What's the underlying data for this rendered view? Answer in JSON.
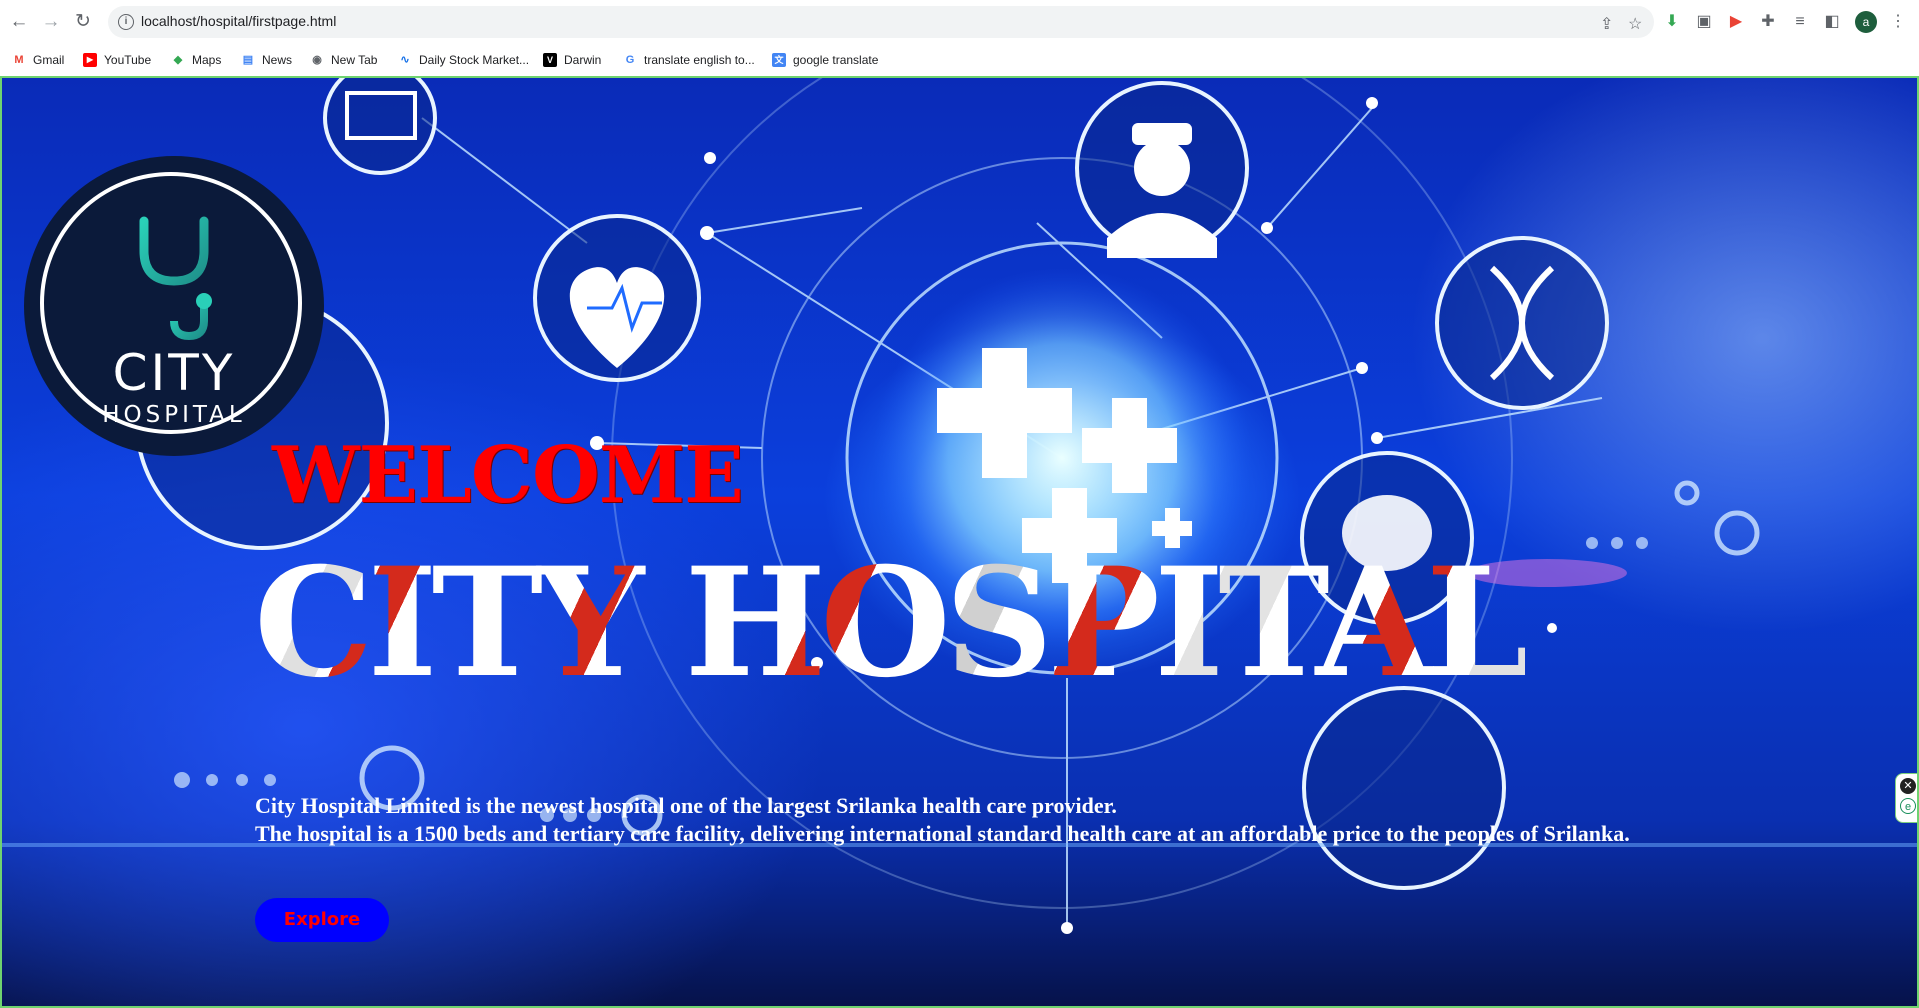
{
  "browser": {
    "url": "localhost/hospital/firstpage.html",
    "profile_initial": "a",
    "nav": {
      "back_icon": "←",
      "forward_icon": "→",
      "reload_icon": "↻"
    },
    "bookmarks": [
      {
        "label": "Gmail",
        "icon": "M",
        "color": "#ea4335"
      },
      {
        "label": "YouTube",
        "icon": "▶",
        "color": "#ff0000"
      },
      {
        "label": "Maps",
        "icon": "◆",
        "color": "#34a853"
      },
      {
        "label": "News",
        "icon": "▤",
        "color": "#4285f4"
      },
      {
        "label": "New Tab",
        "icon": "◉",
        "color": "#5f6368"
      },
      {
        "label": "Daily Stock Market...",
        "icon": "∿",
        "color": "#1a73e8"
      },
      {
        "label": "Darwin",
        "icon": "V",
        "color": "#000000"
      },
      {
        "label": "translate english to...",
        "icon": "G",
        "color": "#4285f4"
      },
      {
        "label": "google translate",
        "icon": "文",
        "color": "#4285f4"
      }
    ]
  },
  "hero": {
    "logo_line1": "CITY",
    "logo_line2": "HOSPITAL",
    "welcome": "WELCOME",
    "title": "CITY HOSPITAL",
    "description_line1": "City Hospital Limited is the newest hospital one of the largest Srilanka health care provider.",
    "description_line2": "The hospital is a 1500 beds and tertiary care facility, delivering international standard health care at an affordable price to the peoples of Srilanka.",
    "explore_label": "Explore"
  },
  "colors": {
    "welcome": "#ff0000",
    "button_bg": "#0000ff",
    "button_text": "#ff0000",
    "accent_red": "#d42a1c"
  }
}
